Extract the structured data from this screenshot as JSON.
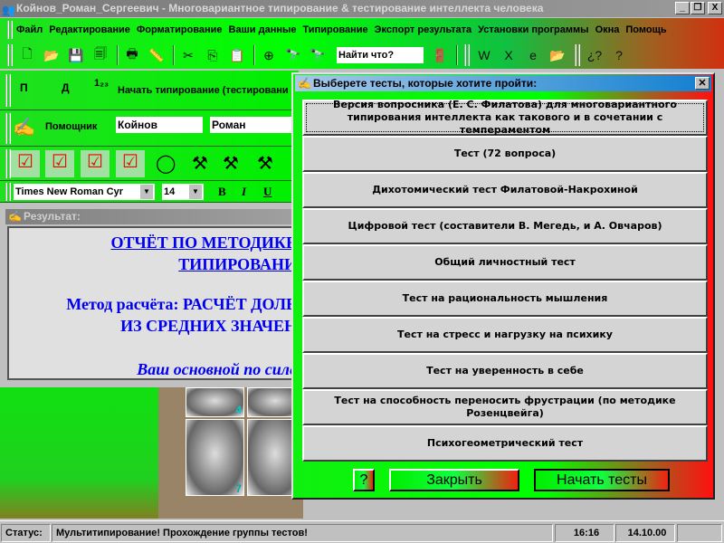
{
  "window": {
    "title": "Койнов_Роман_Сергеевич - Многовариантное типирование & тестирование интеллекта человека",
    "min": "_",
    "max": "❐",
    "close": "X"
  },
  "menu": [
    "Файл",
    "Редактирование",
    "Форматирование",
    "Ваши данные",
    "Типирование",
    "Экспорт результата",
    "Установки программы",
    "Окна",
    "Помощь"
  ],
  "toolbar": {
    "search_placeholder": "Найти что?"
  },
  "typing_row": {
    "p": "П",
    "d": "Д",
    "steps_icon": "1₂₃",
    "start_label": "Начать типирование (тестировани"
  },
  "helper_row": {
    "helper_label": "Помощник",
    "last_name": "Койнов",
    "first_name": "Роман"
  },
  "format_row": {
    "font": "Times New Roman Cyr",
    "size": "14",
    "bold": "B",
    "italic": "I",
    "underline": "U"
  },
  "result": {
    "title": "Результат:",
    "line1": "ОТЧЁТ ПО МЕТОДИКЕ",
    "line2": "ТИПИРОВАНИ",
    "line3": "Метод расчёта: РАСЧЁТ ДОЛЕ",
    "line4": "ИЗ СРЕДНИХ ЗНАЧЕН",
    "line5": "Ваш основной по силе"
  },
  "photo": {
    "n1": "4",
    "n2": "7"
  },
  "dialog": {
    "title": "Выберете тесты, которые хотите пройти:",
    "close": "✕",
    "tests": [
      "Версия вопросника (Е. С. Филатова) для многовариантного типирования интеллекта как такового и в сочетании с темпераментом",
      "Тест (72 вопроса)",
      "Дихотомический тест Филатовой-Накрохиной",
      "Цифровой тест (составители В. Мегедь, и А. Овчаров)",
      "Общий личностный тест",
      "Тест на рациональность мышления",
      "Тест на стресс и нагрузку на психику",
      "Тест на уверенность в себе",
      "Тест на способность переносить фрустрации (по методике Розенцвейга)",
      "Психогеометрический тест"
    ],
    "help": "?",
    "close_btn": "Закрыть",
    "start_btn": "Начать тесты"
  },
  "status": {
    "label": "Статус:",
    "message": "Мультитипирование! Прохождение группы тестов!",
    "time": "16:16",
    "date": "14.10.00"
  }
}
